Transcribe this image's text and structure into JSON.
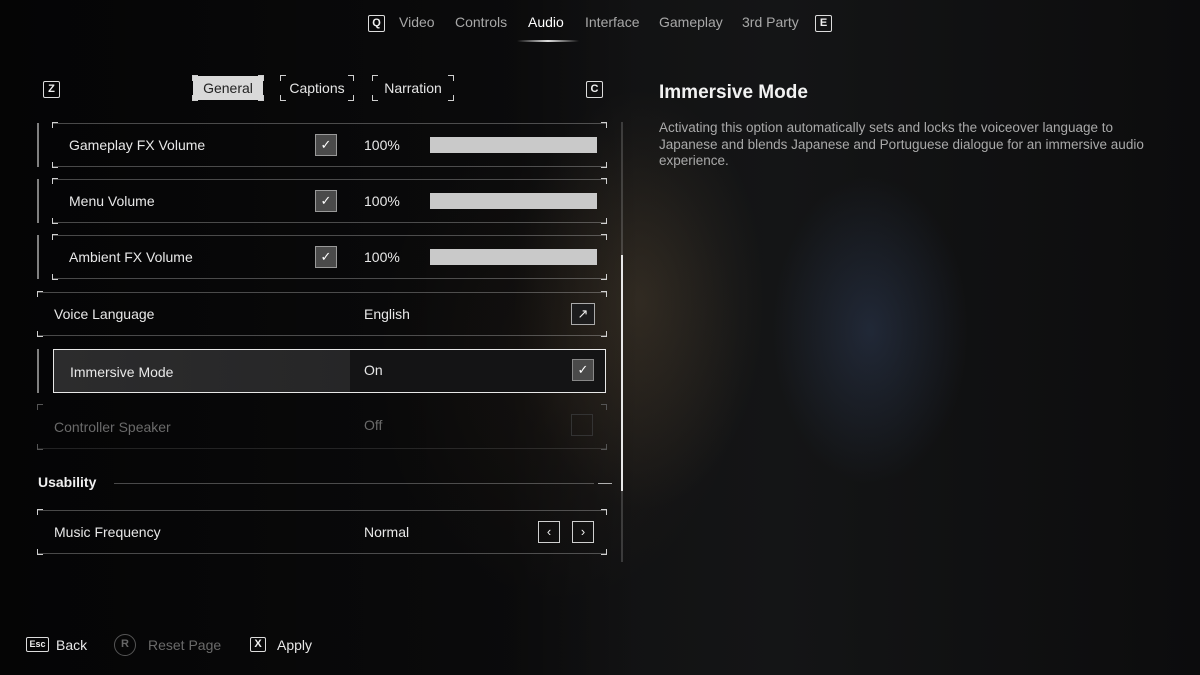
{
  "top_nav": {
    "prev_key": "Q",
    "next_key": "E",
    "tabs": [
      {
        "label": "Video"
      },
      {
        "label": "Controls"
      },
      {
        "label": "Audio"
      },
      {
        "label": "Interface"
      },
      {
        "label": "Gameplay"
      },
      {
        "label": "3rd Party"
      }
    ],
    "active_tab": "Audio"
  },
  "sub_nav": {
    "prev_key": "Z",
    "next_key": "C",
    "tabs": [
      {
        "label": "General"
      },
      {
        "label": "Captions"
      },
      {
        "label": "Narration"
      }
    ],
    "active_tab": "General"
  },
  "settings": {
    "gameplay_fx": {
      "label": "Gameplay FX Volume",
      "value": "100%",
      "checked": true,
      "level": 1.0
    },
    "menu_volume": {
      "label": "Menu Volume",
      "value": "100%",
      "checked": true,
      "level": 1.0
    },
    "ambient_fx": {
      "label": "Ambient FX Volume",
      "value": "100%",
      "checked": true,
      "level": 1.0
    },
    "voice_language": {
      "label": "Voice Language",
      "value": "English",
      "icon": "external-link-icon"
    },
    "immersive_mode": {
      "label": "Immersive Mode",
      "value": "On",
      "checked": true
    },
    "controller_speaker": {
      "label": "Controller Speaker",
      "value": "Off",
      "checked": false,
      "disabled": true
    }
  },
  "usability": {
    "title": "Usability",
    "collapse_glyph": "—",
    "music_frequency": {
      "label": "Music Frequency",
      "value": "Normal",
      "prev_glyph": "‹",
      "next_glyph": "›"
    }
  },
  "description": {
    "title": "Immersive Mode",
    "text": "Activating this option automatically sets and locks the voiceover language to Japanese and blends Japanese and Portuguese dialogue for an immersive audio experience."
  },
  "footer": {
    "back": {
      "key": "Esc",
      "label": "Back"
    },
    "reset": {
      "key": "R",
      "label": "Reset Page"
    },
    "apply": {
      "key": "X",
      "label": "Apply"
    }
  },
  "glyphs": {
    "check": "✓",
    "external": "↗"
  },
  "colors": {
    "accent": "#e8e8e8",
    "active_tab_bg": "#d9d9d9",
    "disabled_text": "#6a6a6a"
  }
}
